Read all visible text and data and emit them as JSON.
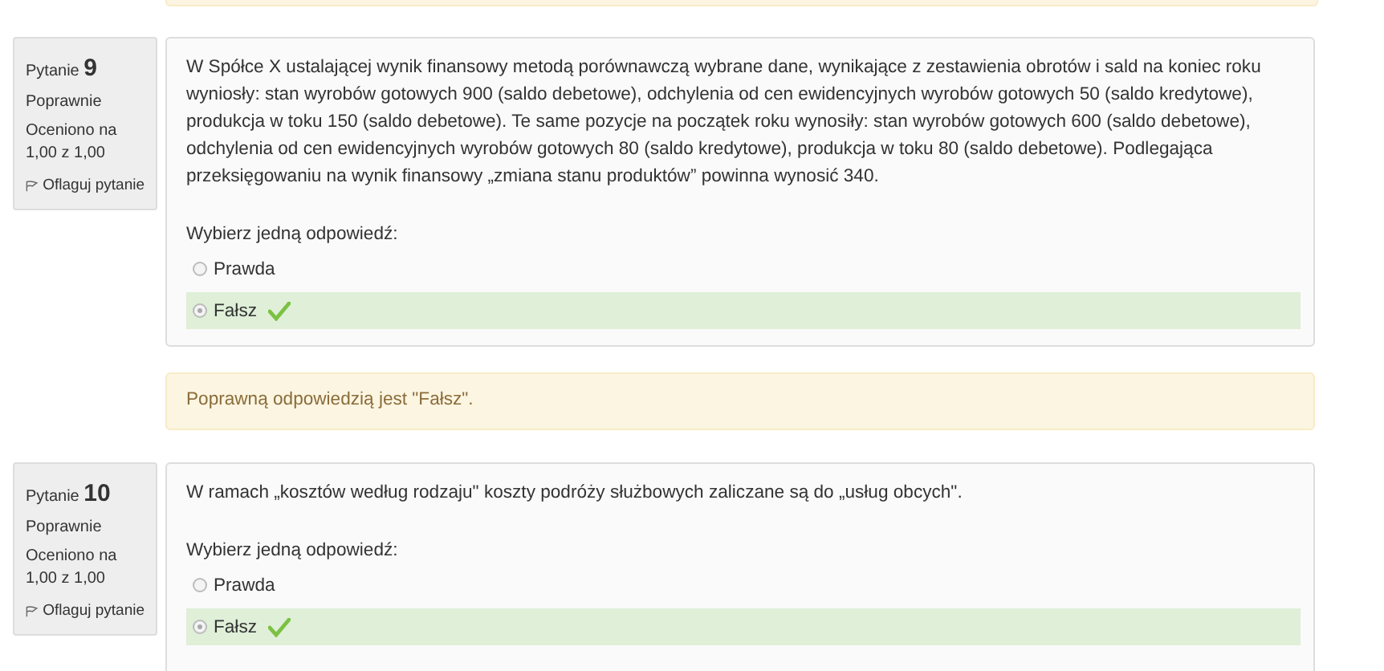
{
  "questions": [
    {
      "label": "Pytanie",
      "number": "9",
      "status": "Poprawnie",
      "grade": "Oceniono na 1,00 z 1,00",
      "flag": "Oflaguj pytanie",
      "text": "W Spółce X ustalającej wynik finansowy metodą porównawczą wybrane dane, wynikające z zestawienia obrotów i sald na koniec roku wyniosły: stan wyrobów gotowych 900 (saldo debetowe), odchylenia od cen ewidencyjnych wyrobów gotowych 50 (saldo kredytowe), produkcja w toku 150 (saldo debetowe). Te same pozycje na początek roku wynosiły: stan wyrobów gotowych 600 (saldo debetowe), odchylenia od cen ewidencyjnych wyrobów gotowych 80 (saldo kredytowe), produkcja w toku 80 (saldo debetowe). Podlegająca przeksięgowaniu na wynik finansowy „zmiana stanu produktów” powinna wynosić 340.",
      "prompt": "Wybierz jedną odpowiedź:",
      "answers": [
        {
          "label": "Prawda",
          "selected": false,
          "correct": false
        },
        {
          "label": "Fałsz",
          "selected": true,
          "correct": true
        }
      ],
      "feedback": "Poprawną odpowiedzią jest \"Fałsz\"."
    },
    {
      "label": "Pytanie",
      "number": "10",
      "status": "Poprawnie",
      "grade": "Oceniono na 1,00 z 1,00",
      "flag": "Oflaguj pytanie",
      "text": "W ramach „kosztów według rodzaju\" koszty podróży służbowych zaliczane są do „usług obcych\".",
      "prompt": "Wybierz jedną odpowiedź:",
      "answers": [
        {
          "label": "Prawda",
          "selected": false,
          "correct": false
        },
        {
          "label": "Fałsz",
          "selected": true,
          "correct": true
        }
      ]
    }
  ]
}
